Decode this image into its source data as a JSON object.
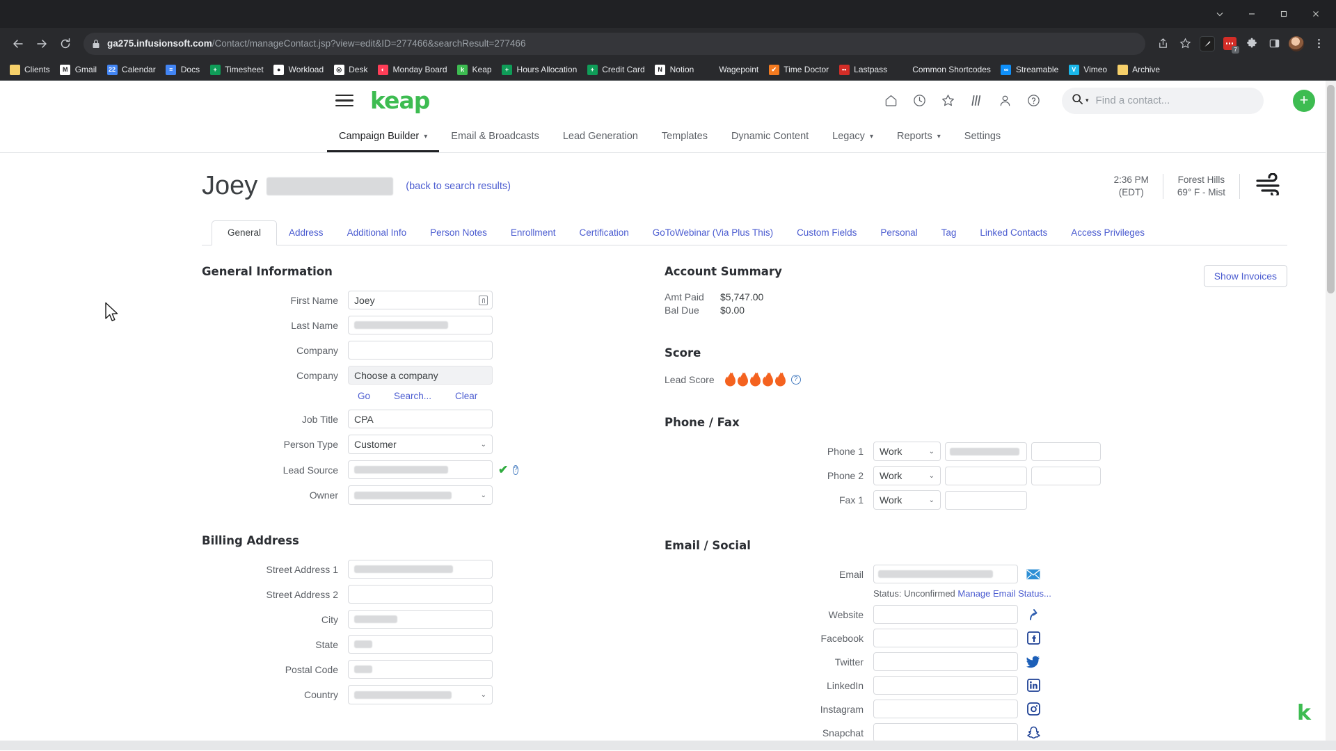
{
  "browser": {
    "url_host": "ga275.infusionsoft.com",
    "url_path": "/Contact/manageContact.jsp?view=edit&ID=277466&searchResult=277466",
    "lastpass_badge": "7",
    "bookmarks": [
      {
        "label": "Clients",
        "icon": "folder-icon",
        "color": "#f6d06a",
        "glyph": ""
      },
      {
        "label": "Gmail",
        "icon": "gmail-icon",
        "color": "#ffffff",
        "glyph": "M"
      },
      {
        "label": "Calendar",
        "icon": "google-calendar-icon",
        "color": "#4285f4",
        "glyph": "22"
      },
      {
        "label": "Docs",
        "icon": "google-docs-icon",
        "color": "#4285f4",
        "glyph": "≡"
      },
      {
        "label": "Timesheet",
        "icon": "sheets-icon",
        "color": "#0f9d58",
        "glyph": "+"
      },
      {
        "label": "Workload",
        "icon": "workload-icon",
        "color": "#ffffff",
        "glyph": "●"
      },
      {
        "label": "Desk",
        "icon": "desk-icon",
        "color": "#ffffff",
        "glyph": "◎"
      },
      {
        "label": "Monday Board",
        "icon": "monday-icon",
        "color": "#ff3d57",
        "glyph": "◐"
      },
      {
        "label": "Keap",
        "icon": "keap-icon",
        "color": "#3dbc51",
        "glyph": "k"
      },
      {
        "label": "Hours Allocation",
        "icon": "sheets-icon",
        "color": "#0f9d58",
        "glyph": "+"
      },
      {
        "label": "Credit Card",
        "icon": "sheets-icon",
        "color": "#0f9d58",
        "glyph": "+"
      },
      {
        "label": "Notion",
        "icon": "notion-icon",
        "color": "#ffffff",
        "glyph": "N"
      },
      {
        "label": "Wagepoint",
        "icon": "none-icon",
        "color": "transparent",
        "glyph": ""
      },
      {
        "label": "Time Doctor",
        "icon": "time-doctor-icon",
        "color": "#f47b20",
        "glyph": "✔"
      },
      {
        "label": "Lastpass",
        "icon": "lastpass-icon",
        "color": "#d32d27",
        "glyph": "••"
      },
      {
        "label": "Common Shortcodes",
        "icon": "none-icon",
        "color": "transparent",
        "glyph": ""
      },
      {
        "label": "Streamable",
        "icon": "streamable-icon",
        "color": "#0f90fa",
        "glyph": "∞"
      },
      {
        "label": "Vimeo",
        "icon": "vimeo-icon",
        "color": "#1ab7ea",
        "glyph": "V"
      },
      {
        "label": "Archive",
        "icon": "folder-icon",
        "color": "#f6d06a",
        "glyph": ""
      }
    ]
  },
  "app": {
    "logo": "keap",
    "search_placeholder": "Find a contact...",
    "add_label": "+",
    "header_icons": [
      "home-icon",
      "clock-icon",
      "star-icon",
      "campaign-icon",
      "person-icon",
      "help-icon"
    ],
    "nav": [
      {
        "label": "Campaign Builder",
        "active": true,
        "caret": true
      },
      {
        "label": "Email & Broadcasts",
        "active": false,
        "caret": false
      },
      {
        "label": "Lead Generation",
        "active": false,
        "caret": false
      },
      {
        "label": "Templates",
        "active": false,
        "caret": false
      },
      {
        "label": "Dynamic Content",
        "active": false,
        "caret": false
      },
      {
        "label": "Legacy",
        "active": false,
        "caret": true
      },
      {
        "label": "Reports",
        "active": false,
        "caret": true
      },
      {
        "label": "Settings",
        "active": false,
        "caret": false
      }
    ]
  },
  "contact": {
    "first_name_display": "Joey",
    "back_link": "(back to search results)",
    "time": "2:36 PM",
    "timezone": "(EDT)",
    "location": "Forest Hills",
    "weather": "69° F - Mist",
    "weather_icon": "wind-icon"
  },
  "tabs": [
    {
      "label": "General",
      "active": true
    },
    {
      "label": "Address",
      "active": false
    },
    {
      "label": "Additional Info",
      "active": false
    },
    {
      "label": "Person Notes",
      "active": false
    },
    {
      "label": "Enrollment",
      "active": false
    },
    {
      "label": "Certification",
      "active": false
    },
    {
      "label": "GoToWebinar (Via Plus This)",
      "active": false
    },
    {
      "label": "Custom Fields",
      "active": false
    },
    {
      "label": "Personal",
      "active": false
    },
    {
      "label": "Tag",
      "active": false
    },
    {
      "label": "Linked Contacts",
      "active": false
    },
    {
      "label": "Access Privileges",
      "active": false
    }
  ],
  "general_information": {
    "heading": "General Information",
    "fields": [
      {
        "label": "First Name",
        "value": "Joey",
        "type": "text",
        "redacted": false,
        "trailing": "contact-card-icon"
      },
      {
        "label": "Last Name",
        "value": "",
        "type": "text",
        "redacted": true
      },
      {
        "label": "Company",
        "value": "",
        "type": "text",
        "redacted": false
      },
      {
        "label": "Company",
        "value": "Choose a company",
        "type": "grey",
        "redacted": false
      },
      {
        "label": "Job Title",
        "value": "CPA",
        "type": "text",
        "redacted": false
      },
      {
        "label": "Person Type",
        "value": "Customer",
        "type": "select",
        "redacted": false
      },
      {
        "label": "Lead Source",
        "value": "",
        "type": "text",
        "redacted": true,
        "trailing": "check-icon"
      },
      {
        "label": "Owner",
        "value": "",
        "type": "select",
        "redacted": true
      }
    ],
    "company_links": [
      "Go",
      "Search...",
      "Clear"
    ]
  },
  "billing_address": {
    "heading": "Billing Address",
    "fields": [
      {
        "label": "Street Address 1",
        "value": "",
        "type": "text",
        "redacted": true
      },
      {
        "label": "Street Address 2",
        "value": "",
        "type": "text",
        "redacted": false
      },
      {
        "label": "City",
        "value": "",
        "type": "text",
        "redacted": true
      },
      {
        "label": "State",
        "value": "",
        "type": "text",
        "redacted": true
      },
      {
        "label": "Postal Code",
        "value": "",
        "type": "text",
        "redacted": true
      },
      {
        "label": "Country",
        "value": "",
        "type": "select",
        "redacted": true
      }
    ]
  },
  "account_summary": {
    "heading": "Account Summary",
    "show_invoices_label": "Show Invoices",
    "rows": [
      {
        "key": "Amt Paid",
        "value": "$5,747.00"
      },
      {
        "key": "Bal Due",
        "value": "$0.00"
      }
    ]
  },
  "score": {
    "heading": "Score",
    "label": "Lead Score",
    "flames": 5,
    "flame_color": "#f4621f"
  },
  "phone_fax": {
    "heading": "Phone / Fax",
    "rows": [
      {
        "label": "Phone 1",
        "type": "Work",
        "number": "",
        "redacted": true,
        "has_ext": true
      },
      {
        "label": "Phone 2",
        "type": "Work",
        "number": "",
        "redacted": false,
        "has_ext": true
      },
      {
        "label": "Fax 1",
        "type": "Work",
        "number": "",
        "redacted": false,
        "has_ext": false
      }
    ]
  },
  "email_social": {
    "heading": "Email / Social",
    "email_label": "Email",
    "email_redacted": true,
    "status_text": "Status: Unconfirmed",
    "status_link": "Manage Email Status...",
    "rows": [
      {
        "label": "Website",
        "value": "",
        "icon": "link-arrow-icon"
      },
      {
        "label": "Facebook",
        "value": "",
        "icon": "facebook-icon"
      },
      {
        "label": "Twitter",
        "value": "",
        "icon": "twitter-icon"
      },
      {
        "label": "LinkedIn",
        "value": "",
        "icon": "linkedin-icon"
      },
      {
        "label": "Instagram",
        "value": "",
        "icon": "instagram-icon"
      },
      {
        "label": "Snapchat",
        "value": "",
        "icon": "snapchat-icon"
      }
    ]
  }
}
